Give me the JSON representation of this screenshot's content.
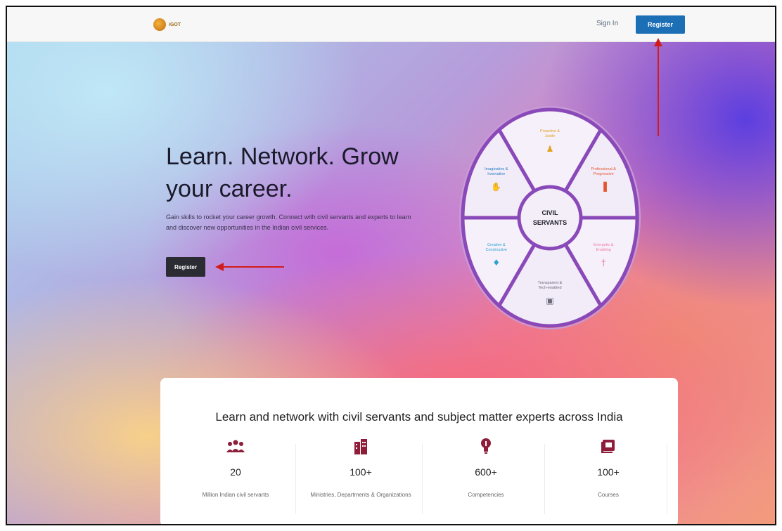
{
  "nav": {
    "logo_text": "iGOT",
    "signin_label": "Sign In",
    "register_label": "Register"
  },
  "hero": {
    "headline": "Learn. Network. Grow your career.",
    "subtitle": "Gain skills to rocket your career growth. Connect with civil servants and experts to learn and discover new opportunities in the Indian civil services.",
    "register_label": "Register"
  },
  "wheel": {
    "center_label": "CIVIL SERVANTS",
    "segments": [
      {
        "label": "Proactive & Jostle",
        "color": "#e0a21a",
        "icon": "person-icon"
      },
      {
        "label": "Professional & Progressive",
        "color": "#e4572e",
        "icon": "bar-chart-icon"
      },
      {
        "label": "Energetic & Enabling",
        "color": "#ee7ea0",
        "icon": "lamp-icon"
      },
      {
        "label": "Transparent & Tech-enabled",
        "color": "#6a6a7a",
        "icon": "monitor-icon"
      },
      {
        "label": "Creative & Constructive",
        "color": "#2aa1d0",
        "icon": "bulb-icon"
      },
      {
        "label": "Imaginative & Innovative",
        "color": "#2b7fc5",
        "icon": "hand-icon"
      }
    ]
  },
  "stats": {
    "title": "Learn and network with civil servants and subject matter experts across India",
    "items": [
      {
        "icon": "people-group-icon",
        "value": "20",
        "label": "Million Indian civil servants"
      },
      {
        "icon": "buildings-icon",
        "value": "100+",
        "label": "Ministries, Departments & Organizations"
      },
      {
        "icon": "lightbulb-icon",
        "value": "600+",
        "label": "Competencies"
      },
      {
        "icon": "course-book-icon",
        "value": "100+",
        "label": "Courses"
      }
    ]
  },
  "colors": {
    "accent": "#1d6fb5",
    "hero_button": "#2b2b33",
    "icon_maroon": "#8e1d3a",
    "annotation_arrow": "#d21c1c"
  }
}
